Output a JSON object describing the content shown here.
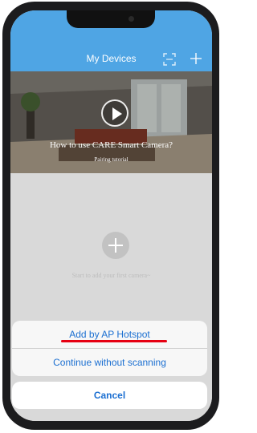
{
  "header": {
    "title": "My Devices",
    "scan_icon": "scan-icon",
    "add_icon": "plus-icon",
    "color": "#4fa5e4"
  },
  "banner": {
    "title": "How to use CARE Smart Camera?",
    "subtitle": "Pairing tutorial",
    "play_icon": "play-icon"
  },
  "empty_state": {
    "add_icon": "plus-icon",
    "text": "Start to add your first camera~"
  },
  "action_sheet": {
    "options": [
      "Add by AP Hotspot",
      "Continue without scanning"
    ],
    "cancel": "Cancel",
    "text_color": "#1b6fd1",
    "highlight_color": "#e60012"
  }
}
